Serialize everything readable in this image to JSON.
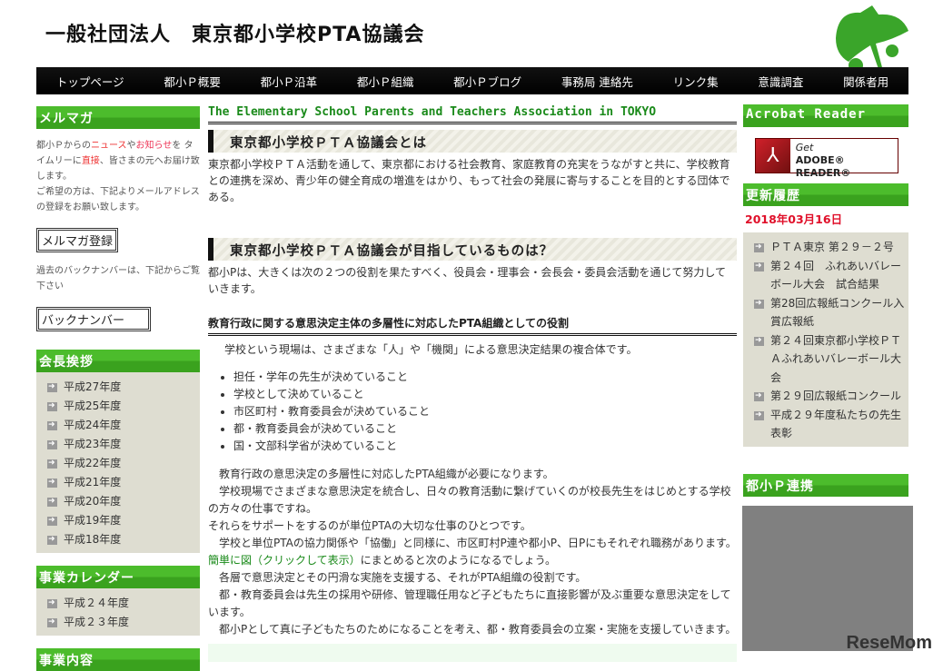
{
  "header": {
    "title": "一般社団法人　東京都小学校PTA協議会"
  },
  "nav": [
    "トップページ",
    "都小Ｐ概要",
    "都小Ｐ沿革",
    "都小Ｐ組織",
    "都小Ｐブログ",
    "事務局 連絡先",
    "リンク集",
    "意識調査",
    "関係者用"
  ],
  "left": {
    "mailmag": {
      "title": "メルマガ",
      "text1a": "都小Ｐからの",
      "news": "ニュース",
      "ya": "や",
      "info": "お知らせ",
      "text1b": "を タイムリーに",
      "direct": "直接",
      "text1c": "、皆さまの元へお届け致します。",
      "text2": "ご希望の方は、下記よりメールアドレスの登録をお願い致します。",
      "register_button": "メルマガ登録",
      "text3": "過去のバックナンバーは、下記からご覧下さい",
      "backnumber_button": "バックナンバー"
    },
    "greeting": {
      "title": "会長挨拶",
      "items": [
        "平成27年度",
        "平成25年度",
        "平成24年度",
        "平成23年度",
        "平成22年度",
        "平成21年度",
        "平成20年度",
        "平成19年度",
        "平成18年度"
      ]
    },
    "calendar": {
      "title": "事業カレンダー",
      "items": [
        "平成２４年度",
        "平成２３年度"
      ]
    },
    "business": {
      "title": "事業内容"
    }
  },
  "main": {
    "english_title": "The Elementary School Parents and Teachers Association in TOKYO",
    "h2_1": "東京都小学校ＰＴＡ協議会とは",
    "p1": "東京都小学校ＰＴＡ活動を通して、東京都における社会教育、家庭教育の充実をうながすと共に、学校教育との連携を深め、青少年の健全育成の増進をはかり、もって社会の発展に寄与することを目的とする団体である。",
    "h2_2": "東京都小学校ＰＴＡ協議会が目指しているものは？",
    "p2": "都小Pは、大きくは次の２つの役割を果たすべく、役員会・理事会・会長会・委員会活動を通じて努力していきます。",
    "h3": "教育行政に関する意思決定主体の多層性に対応したPTA組織としての役割",
    "p3": "　学校という現場は、さまざまな「人」や「機関」による意思決定結果の複合体です。",
    "bullets": [
      "担任・学年の先生が決めていること",
      "学校として決めていること",
      "市区町村・教育委員会が決めていること",
      "都・教育委員会が決めていること",
      "国・文部科学省が決めていること"
    ],
    "paras": [
      "　教育行政の意思決定の多層性に対応したPTA組織が必要になります。",
      "　学校現場でさまざまな意思決定を統合し、日々の教育活動に繋げていくのが校長先生をはじめとする学校の方々の仕事ですね。",
      "それらをサポートをするのが単位PTAの大切な仕事のひとつです。",
      "　学校と単位PTAの協力関係や「協働」と同様に、市区町村P連や都小P、日Pにもそれぞれ職務があります。"
    ],
    "link": "簡単に図（クリックして表示）",
    "link_after": "にまとめると次のようになるでしょう。",
    "paras2": [
      "　各層で意思決定とその円滑な実施を支援する、それがPTA組織の役割です。",
      "　都・教育委員会は先生の採用や研修、管理職任用など子どもたちに直接影響が及ぶ重要な意思決定をしています。",
      "　都小Pとして真に子どもたちのためになることを考え、都・教育委員会の立案・実施を支援していきます。"
    ]
  },
  "right": {
    "acrobat": {
      "title": "Acrobat Reader",
      "get": "Get",
      "reader": "ADOBE® READER®"
    },
    "updates": {
      "title": "更新履歴",
      "date": "2018年03月16日",
      "items": [
        "ＰＴＡ東京 第２９－２号",
        "第２４回　ふれあいバレーボール大会　試合結果",
        "第28回広報紙コンクール入賞広報紙",
        "第２４回東京都小学校ＰＴＡふれあいバレーボール大会",
        "第２９回広報紙コンクール",
        "平成２９年度私たちの先生表彰"
      ]
    },
    "links": {
      "title": "都小Ｐ連携"
    }
  },
  "watermark": "ReseMom"
}
